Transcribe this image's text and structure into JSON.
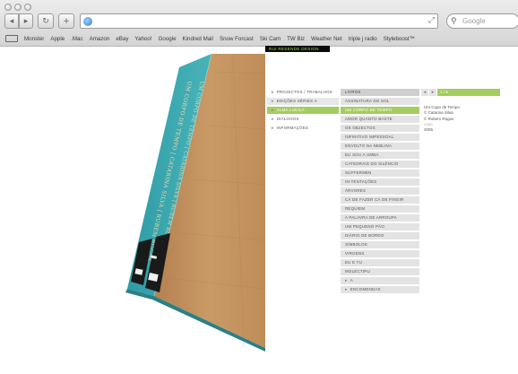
{
  "browser": {
    "search_placeholder": "Google",
    "back_glyph": "◂",
    "forward_glyph": "▸",
    "reload_glyph": "↻",
    "add_glyph": "+",
    "bookmarks": [
      "Monster",
      "Apple",
      ".Mac",
      "Amazon",
      "eBay",
      "Yahoo!",
      "Google",
      "Kindred Mail",
      "Snow Forcast",
      "Ski Cam",
      "TW Biz",
      "Weather Net",
      "triple j radio",
      "Styleboost™"
    ]
  },
  "site": {
    "tag": "RUI RESENDE DESIGN",
    "menu_main": [
      {
        "label": "PROJECTOS / TRABALHOS",
        "state": "normal"
      },
      {
        "label": "EDIÇÕES SÉRIES A",
        "state": "light"
      },
      {
        "label": "ALMA LUCILA",
        "state": "selected"
      },
      {
        "label": "DIÁLOGOS",
        "state": "normal"
      },
      {
        "label": "INFORMAÇÕES",
        "state": "normal"
      }
    ],
    "menu_titles": [
      {
        "label": "LIVROS",
        "state": "head"
      },
      {
        "label": "ASSINATURA DO SOL",
        "state": "normal"
      },
      {
        "label": "UM CORPO DE TEMPO",
        "state": "selected"
      },
      {
        "label": "AMOR QUANTO BASTE",
        "state": "normal"
      },
      {
        "label": "OS OBJECTOS",
        "state": "normal"
      },
      {
        "label": "INFINITIVO IMPESSOAL",
        "state": "normal"
      },
      {
        "label": "ENVOLTO NA NEBLINA",
        "state": "normal"
      },
      {
        "label": "EU SOU A UMBA",
        "state": "normal"
      },
      {
        "label": "CATEDRAIS DO SILÊNCIO",
        "state": "normal"
      },
      {
        "label": "SUFFERMEN",
        "state": "normal"
      },
      {
        "label": "IN-TENTAÇÕES",
        "state": "normal"
      },
      {
        "label": "ÁRVORES",
        "state": "normal"
      },
      {
        "label": "CÁ DE FAZER CÁ DE FINGIR",
        "state": "normal"
      },
      {
        "label": "REQUIEM",
        "state": "normal"
      },
      {
        "label": "A PALAVRA DE ARROUPA",
        "state": "normal"
      },
      {
        "label": "UM PEQUENO PÃO",
        "state": "normal"
      },
      {
        "label": "DIÁRIO DE BORDO",
        "state": "normal"
      },
      {
        "label": "SÍMBOLOS",
        "state": "normal"
      },
      {
        "label": "VIRGENS",
        "state": "normal"
      },
      {
        "label": "EU E TU",
        "state": "normal"
      },
      {
        "label": "MOLÉCTIPU",
        "state": "normal"
      },
      {
        "label": "A",
        "state": "arrow"
      },
      {
        "label": "ENCOMENDAS",
        "state": "arrow"
      }
    ],
    "pager": {
      "prev": "◂",
      "next": "▸",
      "label": "1 / 5"
    },
    "details": [
      {
        "text": "Um Copo de Tempo",
        "muted": false
      },
      {
        "text": "© Catarina Silva",
        "muted": false
      },
      {
        "text": "© Rubem Rugus",
        "muted": false
      },
      {
        "text": "capa",
        "muted": true
      },
      {
        "text": "2005",
        "muted": false
      }
    ]
  },
  "book": {
    "spine_title_1": "UM CORPO DE TEMPO | CATARINA SILVA | RUBEM RUGUS",
    "spine_title_2": "UM CORPO DE TEMPO | CATARINA SILVA | RUBEM RUGUS",
    "teal": "#3aa9b1",
    "cardboard": "#c49560",
    "dark": "#1a1a1a"
  }
}
